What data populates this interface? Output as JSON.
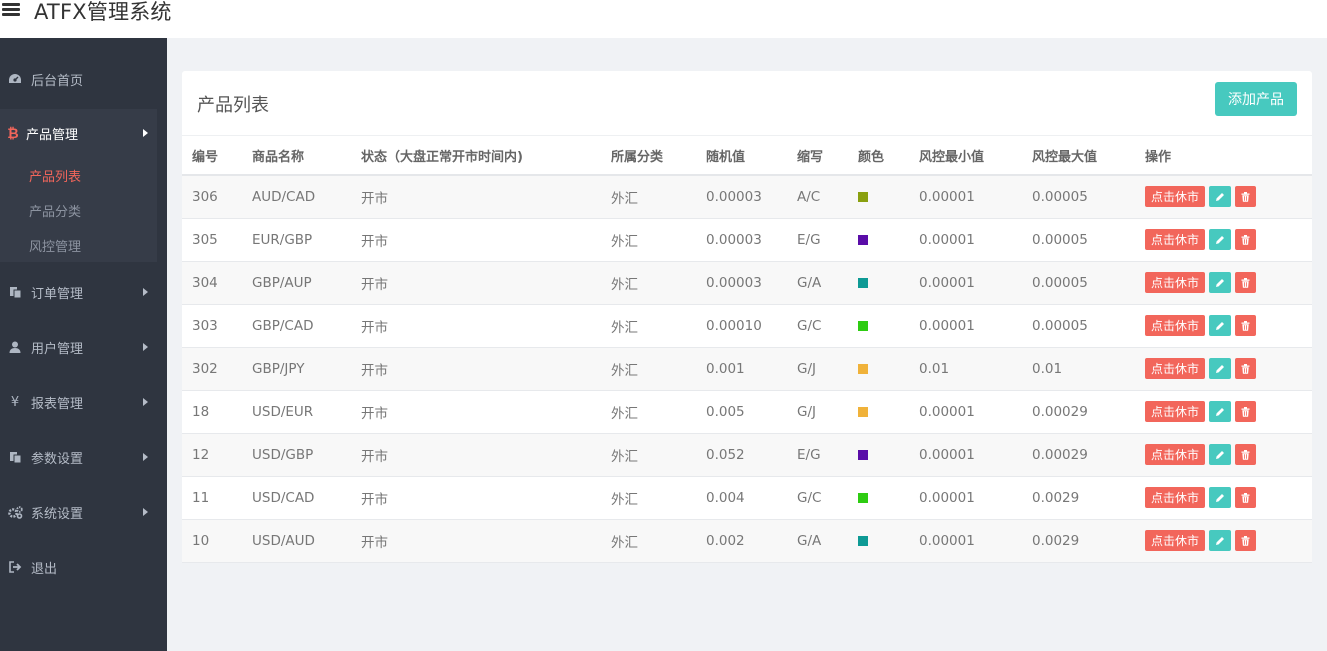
{
  "app": {
    "title": "ATFX管理系统"
  },
  "sidebar": {
    "dashboard": {
      "label": "后台首页",
      "icon": "dashboard-icon"
    },
    "product_group": {
      "label": "产品管理",
      "icon": "bitcoin-icon",
      "children": [
        {
          "label": "产品列表",
          "active": true
        },
        {
          "label": "产品分类",
          "active": false
        },
        {
          "label": "风控管理",
          "active": false
        }
      ]
    },
    "items": [
      {
        "label": "订单管理",
        "icon": "copy-icon"
      },
      {
        "label": "用户管理",
        "icon": "user-icon"
      },
      {
        "label": "报表管理",
        "icon": "yen-icon"
      },
      {
        "label": "参数设置",
        "icon": "copy-icon"
      },
      {
        "label": "系统设置",
        "icon": "gears-icon"
      }
    ],
    "logout": {
      "label": "退出",
      "icon": "sign-out-icon"
    }
  },
  "panel": {
    "title": "产品列表",
    "add_button": "添加产品"
  },
  "table": {
    "headers": [
      "编号",
      "商品名称",
      "状态（大盘正常开市时间内)",
      "所属分类",
      "随机值",
      "缩写",
      "颜色",
      "风控最小值",
      "风控最大值",
      "操作"
    ],
    "rows": [
      {
        "id": "306",
        "name": "AUD/CAD",
        "status": "开市",
        "category": "外汇",
        "random": "0.00003",
        "abbr": "A/C",
        "color": "#8aa010",
        "min": "0.00001",
        "max": "0.00005",
        "action": "点击休市"
      },
      {
        "id": "305",
        "name": "EUR/GBP",
        "status": "开市",
        "category": "外汇",
        "random": "0.00003",
        "abbr": "E/G",
        "color": "#5a0da8",
        "min": "0.00001",
        "max": "0.00005",
        "action": "点击休市"
      },
      {
        "id": "304",
        "name": "GBP/AUP",
        "status": "开市",
        "category": "外汇",
        "random": "0.00003",
        "abbr": "G/A",
        "color": "#0e9a95",
        "min": "0.00001",
        "max": "0.00005",
        "action": "点击休市"
      },
      {
        "id": "303",
        "name": "GBP/CAD",
        "status": "开市",
        "category": "外汇",
        "random": "0.00010",
        "abbr": "G/C",
        "color": "#2ecc12",
        "min": "0.00001",
        "max": "0.00005",
        "action": "点击休市"
      },
      {
        "id": "302",
        "name": "GBP/JPY",
        "status": "开市",
        "category": "外汇",
        "random": "0.001",
        "abbr": "G/J",
        "color": "#f0b23a",
        "min": "0.01",
        "max": "0.01",
        "action": "点击休市"
      },
      {
        "id": "18",
        "name": "USD/EUR",
        "status": "开市",
        "category": "外汇",
        "random": "0.005",
        "abbr": "G/J",
        "color": "#f0b23a",
        "min": "0.00001",
        "max": "0.00029",
        "action": "点击休市"
      },
      {
        "id": "12",
        "name": "USD/GBP",
        "status": "开市",
        "category": "外汇",
        "random": "0.052",
        "abbr": "E/G",
        "color": "#5a0da8",
        "min": "0.00001",
        "max": "0.00029",
        "action": "点击休市"
      },
      {
        "id": "11",
        "name": "USD/CAD",
        "status": "开市",
        "category": "外汇",
        "random": "0.004",
        "abbr": "G/C",
        "color": "#2ecc12",
        "min": "0.00001",
        "max": "0.0029",
        "action": "点击休市"
      },
      {
        "id": "10",
        "name": "USD/AUD",
        "status": "开市",
        "category": "外汇",
        "random": "0.002",
        "abbr": "G/A",
        "color": "#0e9a95",
        "min": "0.00001",
        "max": "0.0029",
        "action": "点击休市"
      }
    ]
  }
}
